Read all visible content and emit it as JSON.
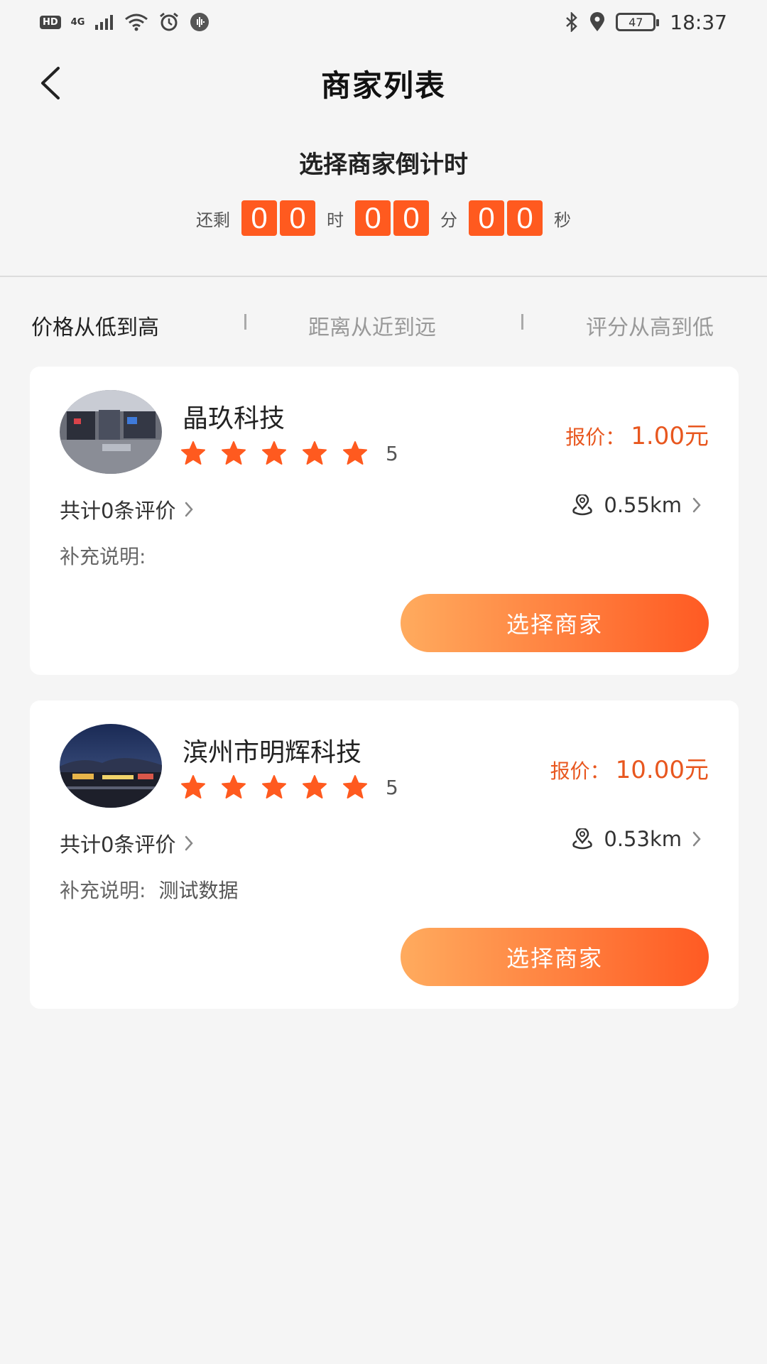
{
  "status_bar": {
    "hd": "HD",
    "network": "4G",
    "battery": "47",
    "time": "18:37"
  },
  "header": {
    "title": "商家列表"
  },
  "countdown": {
    "title": "选择商家倒计时",
    "prefix": "还剩",
    "hours": [
      "0",
      "0"
    ],
    "hour_label": "时",
    "minutes": [
      "0",
      "0"
    ],
    "minute_label": "分",
    "seconds": [
      "0",
      "0"
    ],
    "second_label": "秒"
  },
  "sort": {
    "tabs": [
      "价格从低到高",
      "距离从近到远",
      "评分从高到低"
    ],
    "active_index": 0
  },
  "merchants": [
    {
      "name": "晶玖科技",
      "stars": 5,
      "rating": "5",
      "price_label": "报价：",
      "price_value": "1.00元",
      "reviews": "共计0条评价",
      "distance": "0.55km",
      "note_label": "补充说明:",
      "note_value": "",
      "button": "选择商家"
    },
    {
      "name": "滨州市明辉科技",
      "stars": 5,
      "rating": "5",
      "price_label": "报价：",
      "price_value": "10.00元",
      "reviews": "共计0条评价",
      "distance": "0.53km",
      "note_label": "补充说明:",
      "note_value": "测试数据",
      "button": "选择商家"
    }
  ],
  "colors": {
    "accent": "#ff5a1f",
    "price": "#e8571f",
    "star": "#ff5a1f",
    "button_start": "#ffab5e",
    "button_end": "#ff5a23"
  },
  "icons": {
    "back": "chevron-left-icon",
    "star": "star-icon",
    "location": "location-pin-icon",
    "chevron": "chevron-right-icon"
  }
}
